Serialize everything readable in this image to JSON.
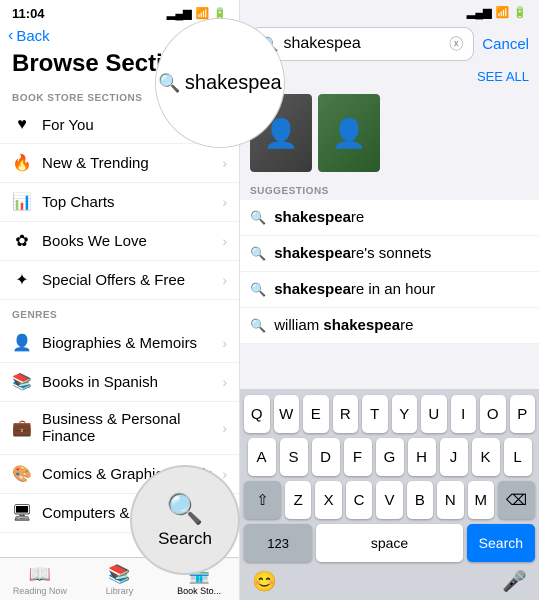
{
  "left": {
    "status": {
      "time": "11:04",
      "signal": "▂▄▆",
      "wifi": "WiFi",
      "battery": "🔋"
    },
    "back_label": "Back",
    "page_title": "Browse Sections",
    "section_book_store": "BOOK STORE SECTIONS",
    "section_genres": "GENRES",
    "menu_items": [
      {
        "id": "for-you",
        "icon": "♥",
        "label": "For You"
      },
      {
        "id": "new-trending",
        "icon": "🔥",
        "label": "New & Trending"
      },
      {
        "id": "top-charts",
        "icon": "📊",
        "label": "Top Charts"
      },
      {
        "id": "books-we-love",
        "icon": "✿",
        "label": "Books We Love"
      },
      {
        "id": "special-offers",
        "icon": "✦",
        "label": "Special Offers & Free"
      }
    ],
    "genre_items": [
      {
        "id": "biographies",
        "icon": "👤",
        "label": "Biographies & Memoirs"
      },
      {
        "id": "books-spanish",
        "icon": "📚",
        "label": "Books in Spanish"
      },
      {
        "id": "business-finance",
        "icon": "💼",
        "label": "Business & Personal Finance"
      },
      {
        "id": "comics",
        "icon": "🎨",
        "label": "Comics & Graphic Novels"
      },
      {
        "id": "computers",
        "icon": "🖥",
        "label": "Computers & Internet"
      }
    ],
    "tabs": [
      {
        "id": "reading-now",
        "icon": "📖",
        "label": "Reading Now"
      },
      {
        "id": "library",
        "icon": "📚",
        "label": "Library"
      },
      {
        "id": "book-store",
        "icon": "🏪",
        "label": "Book Sto...",
        "active": true
      }
    ]
  },
  "right": {
    "status_icons": "▂▄▆  🔋",
    "search_query": "shakespea",
    "cancel_label": "Cancel",
    "see_all_label": "SEE ALL",
    "suggestions_header": "SUGGESTIONS",
    "suggestions": [
      {
        "id": "s1",
        "text": "shakespeare",
        "bold_part": "shakespea",
        "rest": "re"
      },
      {
        "id": "s2",
        "text": "shakespeare's sonnets",
        "bold_part": "shakespea",
        "rest": "re's sonnets"
      },
      {
        "id": "s3",
        "text": "shakespeare in an hour",
        "bold_part": "shakespea",
        "rest": "re in an hour"
      },
      {
        "id": "s4",
        "text": "william shakespeare",
        "bold_part": "shakespea",
        "rest": "re"
      }
    ],
    "keyboard": {
      "row1": [
        "Q",
        "W",
        "E",
        "R",
        "T",
        "Y",
        "U",
        "I",
        "O",
        "P"
      ],
      "row2": [
        "A",
        "S",
        "D",
        "F",
        "G",
        "H",
        "J",
        "K",
        "L"
      ],
      "row3": [
        "Z",
        "X",
        "C",
        "V",
        "B",
        "N",
        "M"
      ],
      "space_label": "space",
      "search_label": "Search",
      "num_label": "123",
      "backspace_icon": "⌫",
      "shift_icon": "⇧",
      "emoji_icon": "😊",
      "mic_icon": "🎤"
    }
  },
  "magnify": {
    "search_icon": "🔍",
    "text": "shakespea"
  },
  "search_circle": {
    "icon": "🔍",
    "label": "Search"
  }
}
